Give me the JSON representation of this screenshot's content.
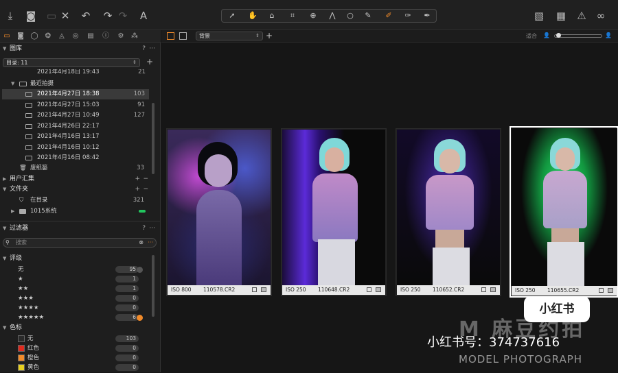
{
  "toolbar": {
    "left_icons": [
      "import-icon",
      "camera-icon",
      "copy-icon",
      "delete-icon",
      "undo-icon",
      "redo-icon",
      "redo-dim-icon",
      "text-icon"
    ],
    "right_icons": [
      "compare-icon",
      "grid-icon",
      "warning-icon",
      "glasses-icon"
    ],
    "accent": "#f08a2a"
  },
  "library": {
    "title": "图库",
    "help": "?",
    "more": "···",
    "catalog": "目录: 11",
    "partial_row": "2021年4月18日 19:43",
    "partial_count": "21",
    "recent_label": "最近拍摄",
    "recent_items": [
      {
        "label": "2021年4月27日 18:38",
        "count": "103",
        "selected": true
      },
      {
        "label": "2021年4月27日 15:03",
        "count": "91"
      },
      {
        "label": "2021年4月27日 10:49",
        "count": "127"
      },
      {
        "label": "2021年4月26日 22:17",
        "count": ""
      },
      {
        "label": "2021年4月16日 13:17",
        "count": ""
      },
      {
        "label": "2021年4月16日 10:12",
        "count": ""
      },
      {
        "label": "2021年4月16日 08:42",
        "count": ""
      }
    ],
    "trash_label": "废纸篓",
    "trash_count": "33",
    "user_collections": "用户汇集",
    "folders": "文件夹",
    "in_catalog": "在目录",
    "in_catalog_count": "321",
    "system_label": "1015系统"
  },
  "filters": {
    "title": "过滤器",
    "search_placeholder": "搜索",
    "rating_title": "评级",
    "ratings": [
      {
        "label": "无",
        "count": "95"
      },
      {
        "label": "★",
        "count": "1"
      },
      {
        "label": "★★",
        "count": "1"
      },
      {
        "label": "★★★",
        "count": "0"
      },
      {
        "label": "★★★★",
        "count": "0"
      },
      {
        "label": "★★★★★",
        "count": "6"
      }
    ],
    "color_title": "色标",
    "colors": [
      {
        "label": "无",
        "count": "103",
        "color": "#2a2a2a"
      },
      {
        "label": "红色",
        "count": "0",
        "color": "#e02a1e"
      },
      {
        "label": "橙色",
        "count": "0",
        "color": "#f08a2a"
      },
      {
        "label": "黄色",
        "count": "0",
        "color": "#e8d020"
      }
    ]
  },
  "browser": {
    "collection": "背景",
    "fit_label": "适合",
    "thumbs": [
      {
        "iso": "ISO 800",
        "file": "110578.CR2"
      },
      {
        "iso": "ISO 250",
        "file": "110648.CR2"
      },
      {
        "iso": "ISO 250",
        "file": "110652.CR2"
      },
      {
        "iso": "ISO 250",
        "file": "110655.CR2",
        "selected": true
      }
    ]
  },
  "watermark": {
    "badge": "小红书",
    "logo": "M 麻豆约拍",
    "id_line": "小红书号：374737616",
    "sub": "MODEL PHOTOGRAPH"
  }
}
